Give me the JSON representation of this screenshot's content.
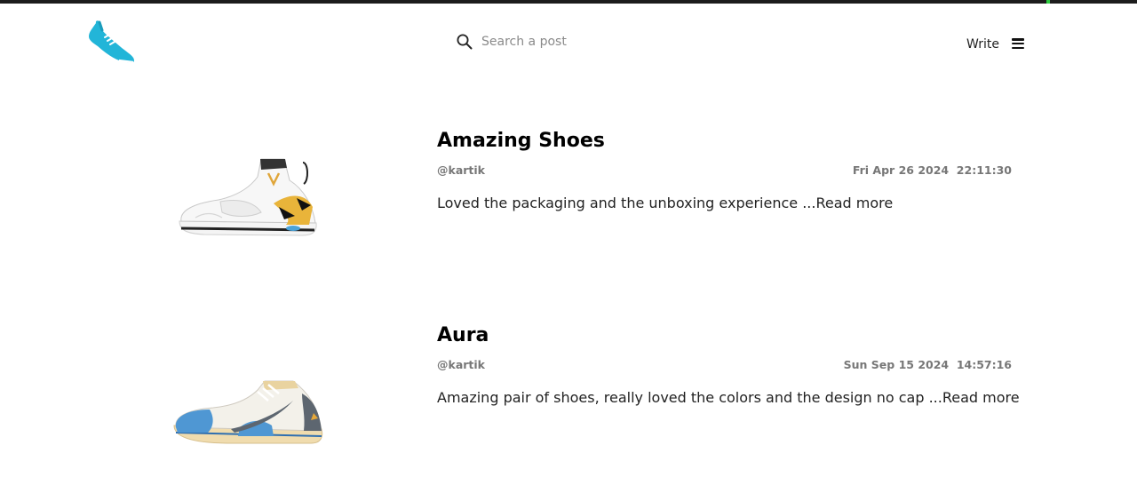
{
  "colors": {
    "brand": "#22b5d8",
    "text": "#111111",
    "muted": "#777777",
    "background": "#ffffff"
  },
  "header": {
    "logo_icon": "running-shoe-icon",
    "search": {
      "icon": "search-icon",
      "placeholder": "Search a post",
      "value": ""
    },
    "write_label": "Write",
    "menu_icon": "hamburger-menu-icon"
  },
  "posts": [
    {
      "title": "Amazing Shoes",
      "author": "@kartik",
      "date": "Fri Apr 26 2024  22:11:30",
      "excerpt": "Loved the packaging and the unboxing experience",
      "read_more": "...Read more",
      "image": "white-yellow-high-top-sneaker"
    },
    {
      "title": "Aura",
      "author": "@kartik",
      "date": "Sun Sep 15 2024  14:57:16",
      "excerpt": "Amazing pair of shoes, really loved the colors and the design no cap",
      "read_more": "...Read more",
      "image": "blue-grey-low-top-sneaker"
    }
  ]
}
